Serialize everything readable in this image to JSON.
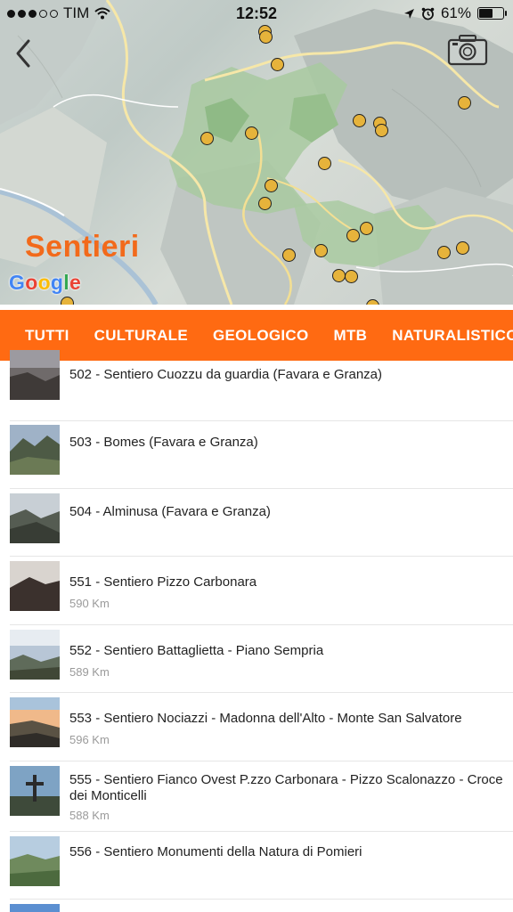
{
  "status_bar": {
    "carrier": "TIM",
    "time": "12:52",
    "battery": "61%",
    "battery_level": 0.61,
    "icons": [
      "signal-dots-icon",
      "wifi-icon",
      "location-arrow-icon",
      "alarm-icon",
      "battery-icon"
    ]
  },
  "map": {
    "title": "Sentieri",
    "google_logo": [
      "G",
      "o",
      "o",
      "g",
      "l",
      "e"
    ],
    "back_icon": "chevron-left-icon",
    "camera_icon": "camera-icon",
    "marker_color": "#e6b33b"
  },
  "tabs": [
    "TUTTI",
    "CULTURALE",
    "GEOLOGICO",
    "MTB",
    "NATURALISTICO"
  ],
  "accent_color": "#ff6a12",
  "trails": [
    {
      "title": "502 - Sentiero Cuozzu da guardia (Favara e Granza)",
      "distance": ""
    },
    {
      "title": "503 - Bomes (Favara e Granza)",
      "distance": ""
    },
    {
      "title": "504 - Alminusa (Favara e Granza)",
      "distance": ""
    },
    {
      "title": "551 - Sentiero Pizzo Carbonara",
      "distance": "590 Km"
    },
    {
      "title": "552 - Sentiero Battaglietta - Piano Sempria",
      "distance": "589 Km"
    },
    {
      "title": "553 - Sentiero Nociazzi - Madonna dell'Alto - Monte San Salvatore",
      "distance": "596 Km"
    },
    {
      "title": "555 - Sentiero Fianco Ovest P.zzo Carbonara - Pizzo Scalonazzo - Croce dei Monticelli",
      "distance": "588 Km"
    },
    {
      "title": "556 - Sentiero Monumenti della Natura di Pomieri",
      "distance": ""
    }
  ]
}
